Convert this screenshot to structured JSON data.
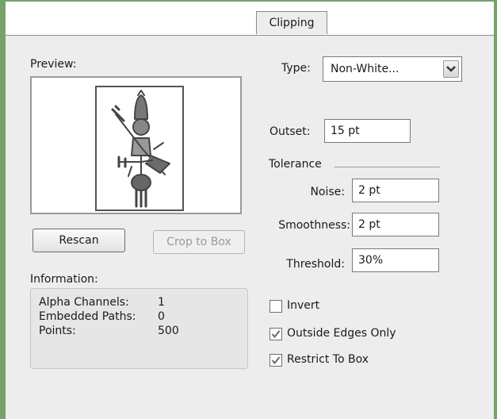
{
  "tabs": [
    {
      "label": "Clipping",
      "active": true
    }
  ],
  "preview": {
    "label": "Preview:"
  },
  "buttons": {
    "rescan": "Rescan",
    "crop_to_box": "Crop to Box"
  },
  "information": {
    "label": "Information:",
    "rows": [
      {
        "name": "Alpha Channels:",
        "value": "1"
      },
      {
        "name": "Embedded Paths:",
        "value": "0"
      },
      {
        "name": "Points:",
        "value": "500"
      }
    ]
  },
  "type": {
    "label": "Type:",
    "value": "Non-White..."
  },
  "outset": {
    "label": "Outset:",
    "value": "15 pt"
  },
  "tolerance": {
    "label": "Tolerance",
    "noise": {
      "label": "Noise:",
      "value": "2 pt"
    },
    "smoothness": {
      "label": "Smoothness:",
      "value": "2 pt"
    },
    "threshold": {
      "label": "Threshold:",
      "value": "30%"
    }
  },
  "options": {
    "invert": {
      "label": "Invert",
      "checked": false
    },
    "outside_edges_only": {
      "label": "Outside Edges Only",
      "checked": true
    },
    "restrict_to_box": {
      "label": "Restrict To Box",
      "checked": true
    }
  },
  "colors": {
    "frame": "#76a36a",
    "panel": "#ededed"
  }
}
